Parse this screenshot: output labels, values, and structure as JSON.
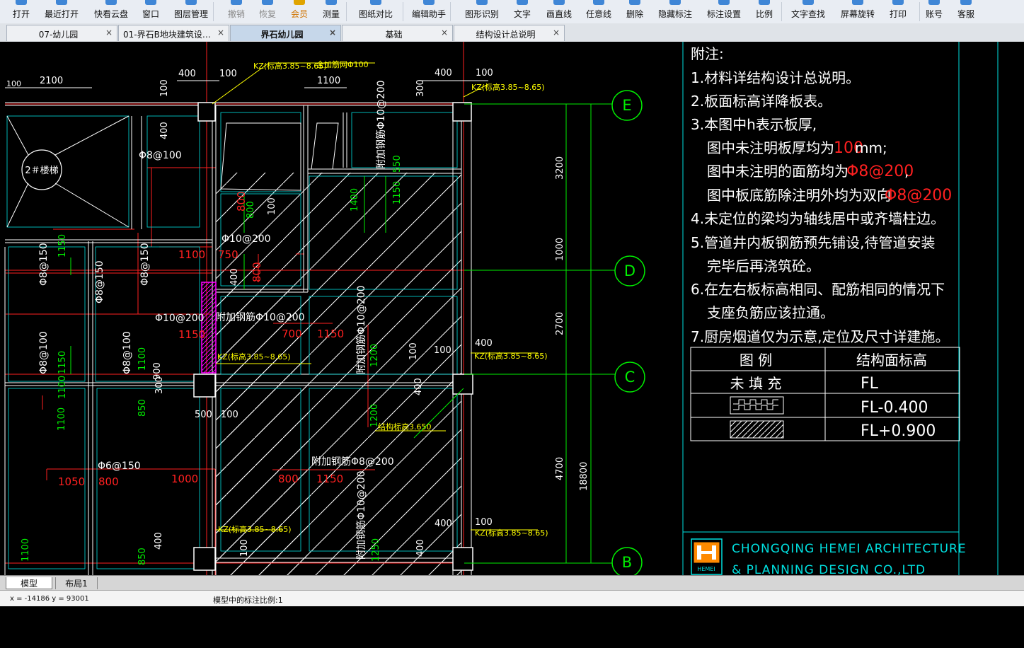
{
  "toolbar": {
    "items": [
      {
        "label": "打开",
        "icon": "folder-open-icon",
        "state": "normal"
      },
      {
        "label": "最近打开",
        "icon": "recent-files-icon",
        "state": "normal"
      },
      {
        "label": "快看云盘",
        "icon": "cloud-drive-icon",
        "state": "normal"
      },
      {
        "label": "窗口",
        "icon": "window-icon",
        "state": "normal"
      },
      {
        "label": "图层管理",
        "icon": "layers-icon",
        "state": "normal"
      },
      {
        "label": "撤销",
        "icon": "undo-icon",
        "state": "disabled"
      },
      {
        "label": "恢复",
        "icon": "redo-icon",
        "state": "disabled"
      },
      {
        "label": "会员",
        "icon": "vip-crown-icon",
        "state": "vip"
      },
      {
        "label": "测量",
        "icon": "measure-icon",
        "state": "normal"
      },
      {
        "label": "图纸对比",
        "icon": "compare-icon",
        "state": "normal"
      },
      {
        "label": "编辑助手",
        "icon": "edit-assistant-icon",
        "state": "normal"
      },
      {
        "label": "图形识别",
        "icon": "shape-recognize-icon",
        "state": "normal"
      },
      {
        "label": "文字",
        "icon": "text-icon",
        "state": "normal"
      },
      {
        "label": "画直线",
        "icon": "line-icon",
        "state": "normal"
      },
      {
        "label": "任意线",
        "icon": "freeline-icon",
        "state": "normal"
      },
      {
        "label": "删除",
        "icon": "delete-icon",
        "state": "normal"
      },
      {
        "label": "隐藏标注",
        "icon": "hide-annotation-icon",
        "state": "normal"
      },
      {
        "label": "标注设置",
        "icon": "annotation-settings-icon",
        "state": "normal"
      },
      {
        "label": "比例",
        "icon": "scale-icon",
        "state": "normal"
      },
      {
        "label": "文字查找",
        "icon": "text-search-icon",
        "state": "normal"
      },
      {
        "label": "屏幕旋转",
        "icon": "rotate-screen-icon",
        "state": "normal"
      },
      {
        "label": "打印",
        "icon": "print-icon",
        "state": "normal"
      },
      {
        "label": "账号",
        "icon": "account-icon",
        "state": "normal"
      },
      {
        "label": "客服",
        "icon": "support-icon",
        "state": "normal"
      }
    ]
  },
  "tabs": [
    {
      "label": "07-幼儿园",
      "active": false
    },
    {
      "label": "01-界石B地块建筑设计说明",
      "active": false
    },
    {
      "label": "界石幼儿园",
      "active": true
    },
    {
      "label": "基础",
      "active": false
    },
    {
      "label": "结构设计总说明",
      "active": false
    }
  ],
  "tab_close_glyph": "×",
  "drawing": {
    "axes": [
      "E",
      "D",
      "C",
      "B"
    ],
    "staircase_label": "2＃楼梯",
    "dimensions_white": [
      "2100",
      "400",
      "100",
      "1100",
      "400",
      "100",
      "100",
      "400",
      "100",
      "400",
      "900",
      "300",
      "500",
      "100",
      "100",
      "400",
      "100",
      "400",
      "400",
      "100",
      "400",
      "100",
      "400",
      "300"
    ],
    "dimensions_right": [
      "3200",
      "1000",
      "2700",
      "4700",
      "18800"
    ],
    "rebar_white": [
      "Φ8@100",
      "Φ10@200",
      "Φ10@200",
      "附加钢筋Φ10@200",
      "Φ6@150",
      "附加钢筋Φ8@200",
      "附加钢筋Φ10@200",
      "附加钢筋Φ10@200",
      "附加钢筋Φ10@200",
      "Φ8@150",
      "Φ8@150",
      "Φ8@150",
      "Φ8@100",
      "Φ8@100"
    ],
    "red_numbers": [
      "800",
      "1100",
      "750",
      "800",
      "700",
      "1150",
      "1150",
      "1050",
      "800",
      "1000",
      "800",
      "1150"
    ],
    "green_numbers": [
      "1150",
      "800",
      "1400",
      "1150",
      "1150",
      "1100",
      "1100",
      "1100",
      "1200",
      "850",
      "1200",
      "850",
      "1100",
      "1250",
      "550"
    ],
    "yellow_tags": [
      "KZ(标高3.85~8.65)",
      "全加筋网Φ100",
      "KZ(标高3.85~8.65)",
      "KZ(标高3.85~8.65)",
      "KZ(标高3.85~8.65)",
      "KZ(标高3.85~8.65)",
      "KZ(标高3.85~8.65)",
      "结构标高3.650"
    ],
    "partial_left": "100"
  },
  "notes": {
    "heading": "附注:",
    "lines": [
      "1.材料详结构设计总说明。",
      "2.板面标高详降板表。",
      "3.本图中h表示板厚,",
      "4.未定位的梁均为轴线居中或齐墙柱边。",
      "5.管道井内板钢筋预先铺设,待管道安装",
      "完毕后再浇筑砼。",
      "6.在左右板标高相同、配筋相同的情况下",
      "支座负筋应该拉通。",
      "7.厨房烟道仅为示意,定位及尺寸详建施。"
    ],
    "sub3": [
      {
        "text": "图中未注明板厚均为",
        "value": "100",
        "unit": "mm;"
      },
      {
        "text": "图中未注明的面筋均为",
        "value": "Φ8@200",
        "unit": ","
      },
      {
        "text": "图中板底筋除注明外均为双向",
        "value": "Φ8@200",
        "unit": ""
      }
    ]
  },
  "legend": {
    "col1_header": "图 例",
    "col2_header": "结构面标高",
    "rows": [
      {
        "pattern": "none",
        "pattern_label": "未 填 充",
        "value": "FL"
      },
      {
        "pattern": "step",
        "value": "FL-0.400"
      },
      {
        "pattern": "hatch",
        "value": "FL+0.900"
      }
    ]
  },
  "titleblock": {
    "company_line1": "CHONGQING HEMEI ARCHITECTURE",
    "company_line2": "& PLANNING DESIGN CO.,LTD",
    "logo_text": "HEMEI"
  },
  "layout_tabs": [
    {
      "label": "模型",
      "active": true
    },
    {
      "label": "布局1",
      "active": false
    }
  ],
  "status": {
    "coordinates": "x = -14186 y = 93001",
    "annotation_scale": "模型中的标注比例:1"
  },
  "colors": {
    "white": "#ffffff",
    "red": "#ff2020",
    "green": "#00ee00",
    "yellow": "#ffff00",
    "cyan": "#00e0e0",
    "magenta": "#ff00ff"
  }
}
